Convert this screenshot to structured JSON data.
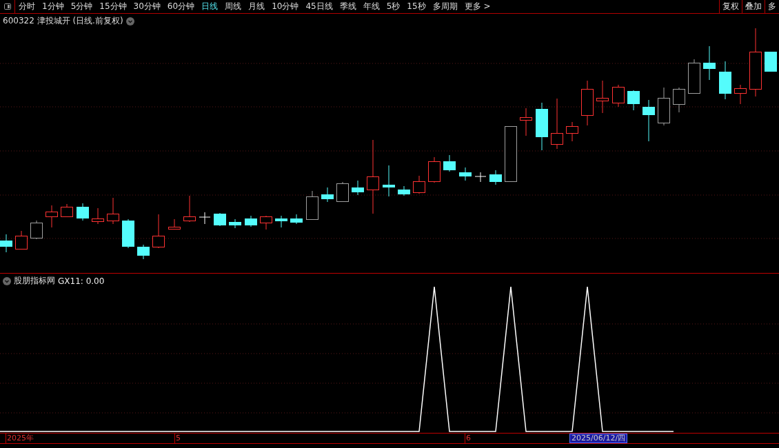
{
  "toolbar": {
    "periods": [
      {
        "label": "分时",
        "selected": false
      },
      {
        "label": "1分钟",
        "selected": false
      },
      {
        "label": "5分钟",
        "selected": false
      },
      {
        "label": "15分钟",
        "selected": false
      },
      {
        "label": "30分钟",
        "selected": false
      },
      {
        "label": "60分钟",
        "selected": false
      },
      {
        "label": "日线",
        "selected": true
      },
      {
        "label": "周线",
        "selected": false
      },
      {
        "label": "月线",
        "selected": false
      },
      {
        "label": "10分钟",
        "selected": false
      },
      {
        "label": "45日线",
        "selected": false
      },
      {
        "label": "季线",
        "selected": false
      },
      {
        "label": "年线",
        "selected": false
      },
      {
        "label": "5秒",
        "selected": false
      },
      {
        "label": "15秒",
        "selected": false
      },
      {
        "label": "多周期",
        "selected": false
      },
      {
        "label": "更多 >",
        "selected": false
      }
    ],
    "buttons": [
      "复权",
      "叠加",
      "多"
    ]
  },
  "main_chart": {
    "title": "600322 津投城开 (日线.前复权)"
  },
  "indicator": {
    "name": "股朋指标网",
    "value": "GX11: 0.00"
  },
  "time_axis": [
    {
      "label": "2025年",
      "highlighted": false
    },
    {
      "label": "5",
      "highlighted": false
    },
    {
      "label": "6",
      "highlighted": false
    },
    {
      "label": "2025/06/12/四",
      "highlighted": true
    }
  ]
}
